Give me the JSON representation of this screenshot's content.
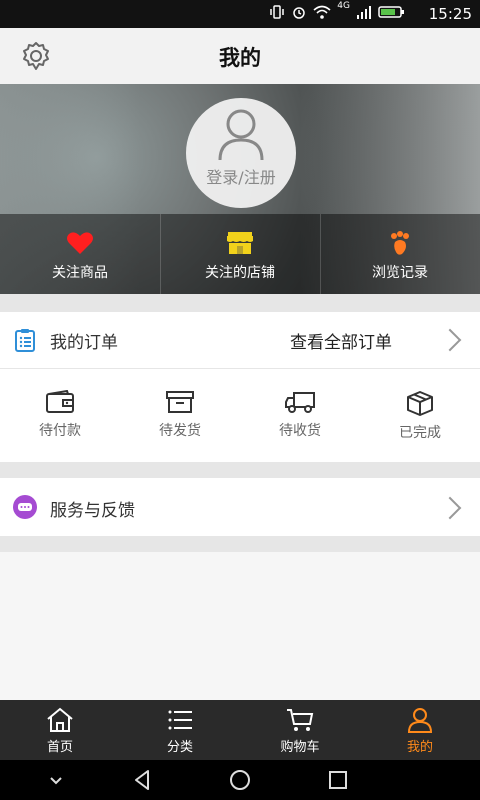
{
  "status_bar": {
    "time": "15:25",
    "network": "4G"
  },
  "header": {
    "title": "我的",
    "settings_icon": "gear-icon"
  },
  "profile": {
    "login_text": "登录/注册",
    "avatar_icon": "user-outline-icon"
  },
  "quick_actions": [
    {
      "label": "关注商品",
      "icon": "heart-icon",
      "color": "#ff1f1f"
    },
    {
      "label": "关注的店铺",
      "icon": "store-icon",
      "color": "#f2d21b"
    },
    {
      "label": "浏览记录",
      "icon": "footprint-icon",
      "color": "#ff7a22"
    }
  ],
  "orders": {
    "title": "我的订单",
    "view_all": "查看全部订单",
    "icon": "clipboard-list-icon",
    "statuses": [
      {
        "label": "待付款",
        "icon": "wallet-icon"
      },
      {
        "label": "待发货",
        "icon": "archive-box-icon"
      },
      {
        "label": "待收货",
        "icon": "delivery-truck-icon"
      },
      {
        "label": "已完成",
        "icon": "package-box-icon"
      }
    ]
  },
  "service": {
    "title": "服务与反馈",
    "icon": "chat-bubble-icon",
    "icon_color": "#a54bd2"
  },
  "tabbar": {
    "items": [
      {
        "label": "首页",
        "icon": "home-icon"
      },
      {
        "label": "分类",
        "icon": "list-icon"
      },
      {
        "label": "购物车",
        "icon": "cart-icon"
      },
      {
        "label": "我的",
        "icon": "user-icon",
        "active": true
      }
    ],
    "active_color": "#ff8a1a"
  },
  "system_nav": {
    "items": [
      "down-icon",
      "back-icon",
      "home-circle-icon",
      "recents-icon"
    ]
  }
}
